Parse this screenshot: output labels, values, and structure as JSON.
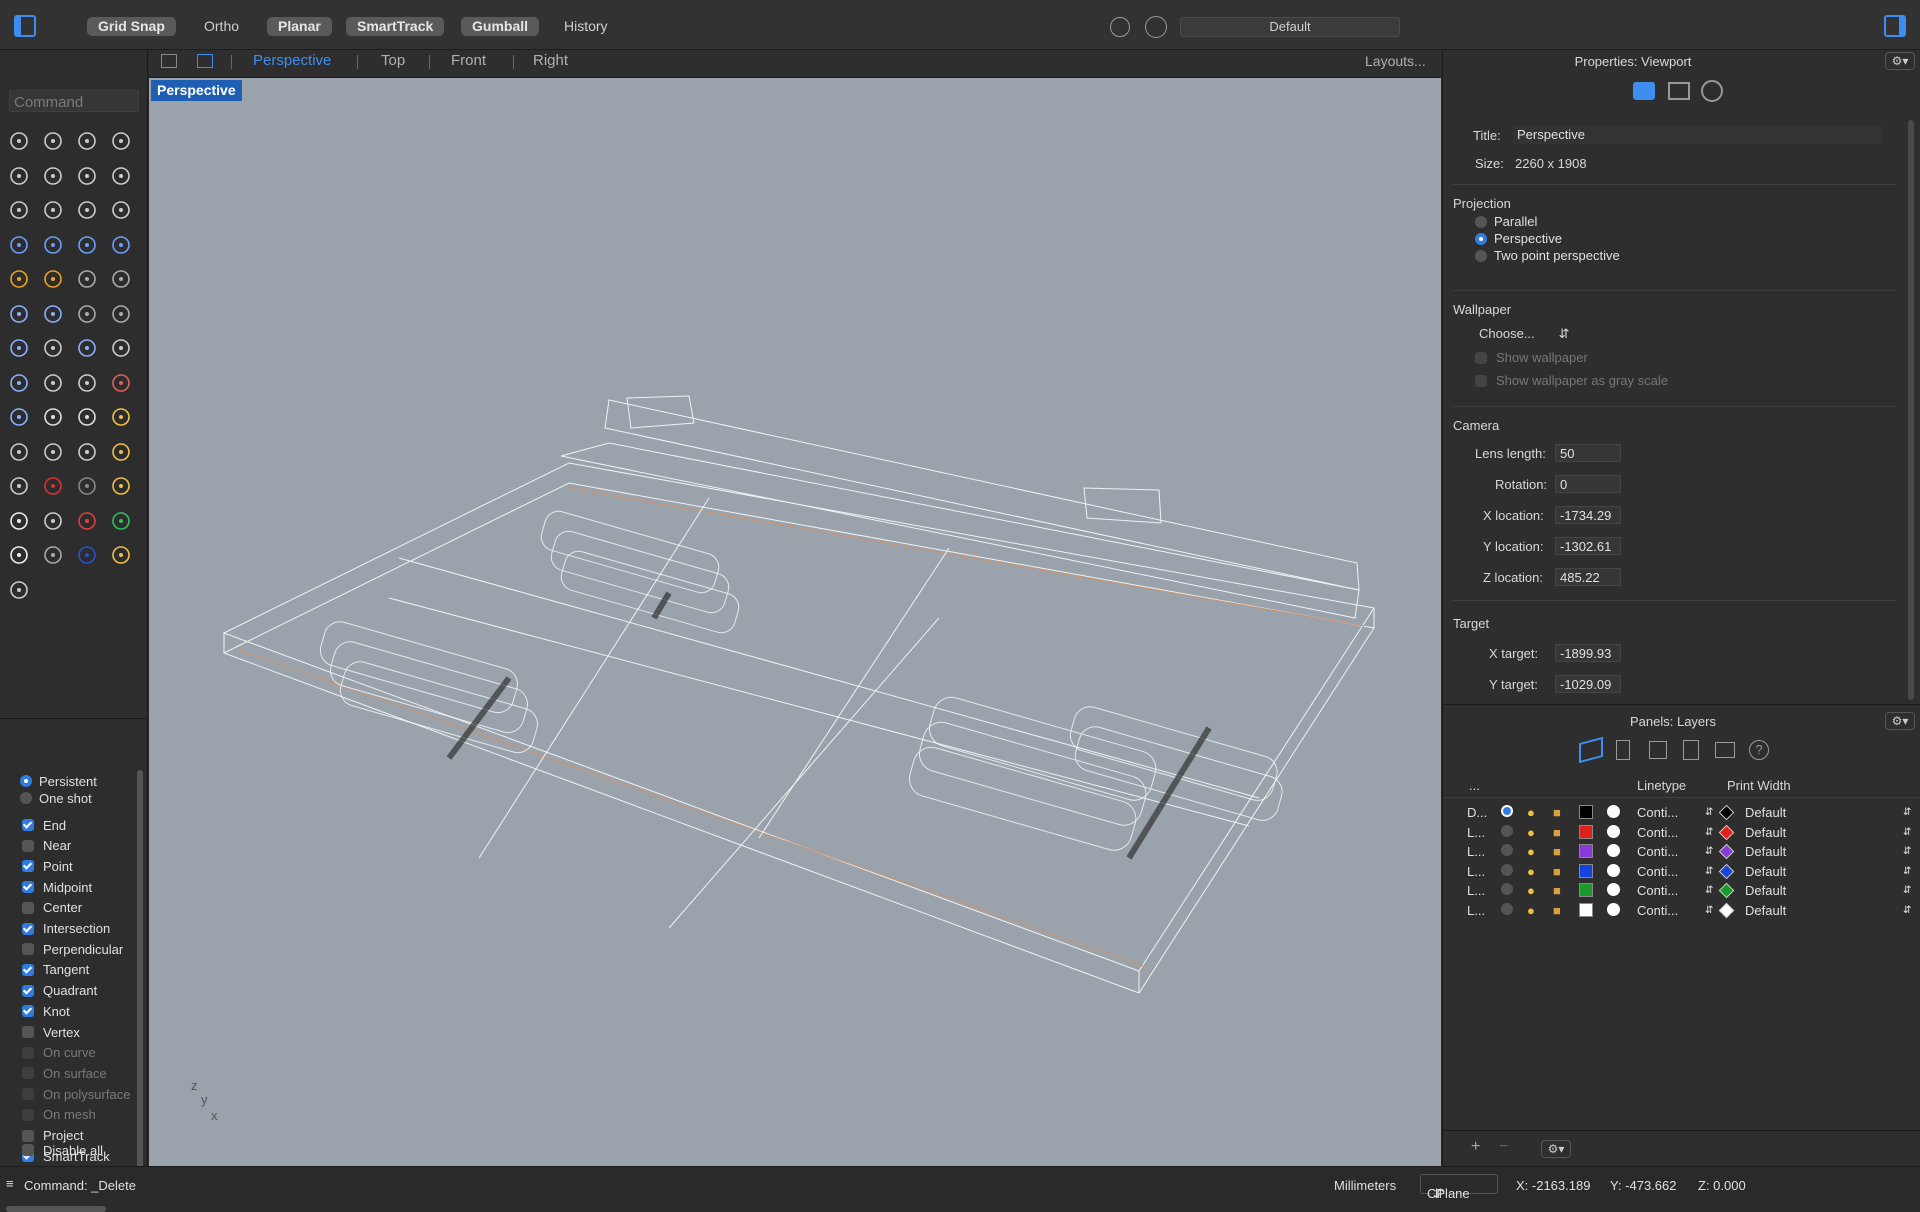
{
  "toolbar": {
    "grid_snap": "Grid Snap",
    "ortho": "Ortho",
    "planar": "Planar",
    "smarttrack": "SmartTrack",
    "gumball": "Gumball",
    "history": "History",
    "display_mode": "Default"
  },
  "command": {
    "placeholder": "Command"
  },
  "view_tabs": {
    "perspective": "Perspective",
    "top": "Top",
    "front": "Front",
    "right": "Right",
    "layouts": "Layouts..."
  },
  "viewport": {
    "label": "Perspective",
    "axes": {
      "z": "z",
      "y": "y",
      "x": "x"
    }
  },
  "osnap": {
    "mode_persistent": "Persistent",
    "mode_one_shot": "One shot",
    "items": [
      {
        "label": "End",
        "checked": true,
        "enabled": true
      },
      {
        "label": "Near",
        "checked": false,
        "enabled": true
      },
      {
        "label": "Point",
        "checked": true,
        "enabled": true
      },
      {
        "label": "Midpoint",
        "checked": true,
        "enabled": true
      },
      {
        "label": "Center",
        "checked": false,
        "enabled": true
      },
      {
        "label": "Intersection",
        "checked": true,
        "enabled": true
      },
      {
        "label": "Perpendicular",
        "checked": false,
        "enabled": true
      },
      {
        "label": "Tangent",
        "checked": true,
        "enabled": true
      },
      {
        "label": "Quadrant",
        "checked": true,
        "enabled": true
      },
      {
        "label": "Knot",
        "checked": true,
        "enabled": true
      },
      {
        "label": "Vertex",
        "checked": false,
        "enabled": true
      },
      {
        "label": "On curve",
        "checked": false,
        "enabled": false
      },
      {
        "label": "On surface",
        "checked": false,
        "enabled": false
      },
      {
        "label": "On polysurface",
        "checked": false,
        "enabled": false
      },
      {
        "label": "On mesh",
        "checked": false,
        "enabled": false
      },
      {
        "label": "Project",
        "checked": false,
        "enabled": true
      },
      {
        "label": "SmartTrack",
        "checked": true,
        "enabled": true
      }
    ],
    "disable_all": "Disable all"
  },
  "properties": {
    "header": "Properties: Viewport",
    "title_label": "Title:",
    "title_value": "Perspective",
    "size_label": "Size:",
    "size_value": "2260 x 1908",
    "projection_label": "Projection",
    "projection_options": [
      "Parallel",
      "Perspective",
      "Two point perspective"
    ],
    "projection_selected": "Perspective",
    "wallpaper_label": "Wallpaper",
    "wallpaper_choose": "Choose...",
    "show_wallpaper": "Show wallpaper",
    "show_wallpaper_gray": "Show wallpaper as gray scale",
    "camera_label": "Camera",
    "lens_length_label": "Lens length:",
    "lens_length": "50",
    "rotation_label": "Rotation:",
    "rotation": "0",
    "x_location_label": "X location:",
    "x_location": "-1734.29",
    "y_location_label": "Y location:",
    "y_location": "-1302.61",
    "z_location_label": "Z location:",
    "z_location": "485.22",
    "target_label": "Target",
    "x_target_label": "X target:",
    "x_target": "-1899.93",
    "y_target_label": "Y target:",
    "y_target": "-1029.09"
  },
  "layers": {
    "header": "Panels: Layers",
    "col_name": "...",
    "col_linetype": "Linetype",
    "col_print_width": "Print Width",
    "rows": [
      {
        "name": "D...",
        "color": "#000000",
        "diamond": "#000000",
        "linetype": "Conti...",
        "width": "Default",
        "current": true
      },
      {
        "name": "L...",
        "color": "#e0201c",
        "diamond": "#e0201c",
        "linetype": "Conti...",
        "width": "Default",
        "current": false
      },
      {
        "name": "L...",
        "color": "#8a3ad8",
        "diamond": "#8a3ad8",
        "linetype": "Conti...",
        "width": "Default",
        "current": false
      },
      {
        "name": "L...",
        "color": "#1444e0",
        "diamond": "#1444e0",
        "linetype": "Conti...",
        "width": "Default",
        "current": false
      },
      {
        "name": "L...",
        "color": "#1a9a2a",
        "diamond": "#1a9a2a",
        "linetype": "Conti...",
        "width": "Default",
        "current": false
      },
      {
        "name": "L...",
        "color": "#ffffff",
        "diamond": "#ffffff",
        "linetype": "Conti...",
        "width": "Default",
        "current": false
      }
    ]
  },
  "status": {
    "command": "Command: _Delete",
    "units": "Millimeters",
    "cplane": "CPlane",
    "x": "X: -2163.189",
    "y": "Y: -473.662",
    "z": "Z: 0.000"
  }
}
